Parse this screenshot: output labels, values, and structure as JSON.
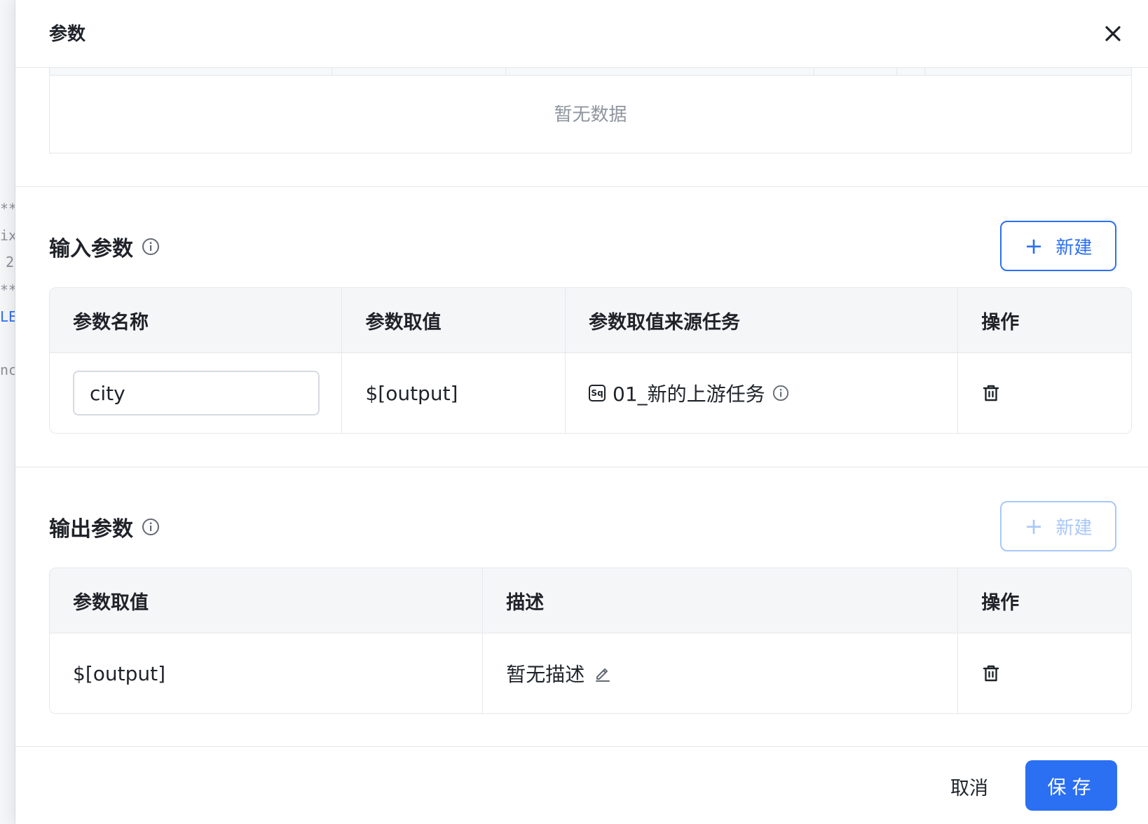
{
  "background": {
    "fragments": [
      "**",
      "ix",
      "2",
      "**",
      "LE",
      "nc"
    ]
  },
  "drawer": {
    "title": "参数"
  },
  "top_table": {
    "empty_text": "暂无数据"
  },
  "input_params": {
    "title": "输入参数",
    "add_label": "新建",
    "columns": [
      "参数名称",
      "参数取值",
      "参数取值来源任务",
      "操作"
    ],
    "rows": [
      {
        "name": "city",
        "value": "$[output]",
        "source_task": "01_新的上游任务",
        "source_icon": "Sq"
      }
    ]
  },
  "output_params": {
    "title": "输出参数",
    "add_label": "新建",
    "columns": [
      "参数取值",
      "描述",
      "操作"
    ],
    "rows": [
      {
        "value": "$[output]",
        "description": "暂无描述"
      }
    ]
  },
  "footer": {
    "cancel_label": "取消",
    "save_label": "保存"
  },
  "colors": {
    "primary": "#2b6ff2",
    "primary_disabled": "#a9c7f8",
    "border": "#e5e7eb",
    "header_bg": "#f5f6f8"
  }
}
